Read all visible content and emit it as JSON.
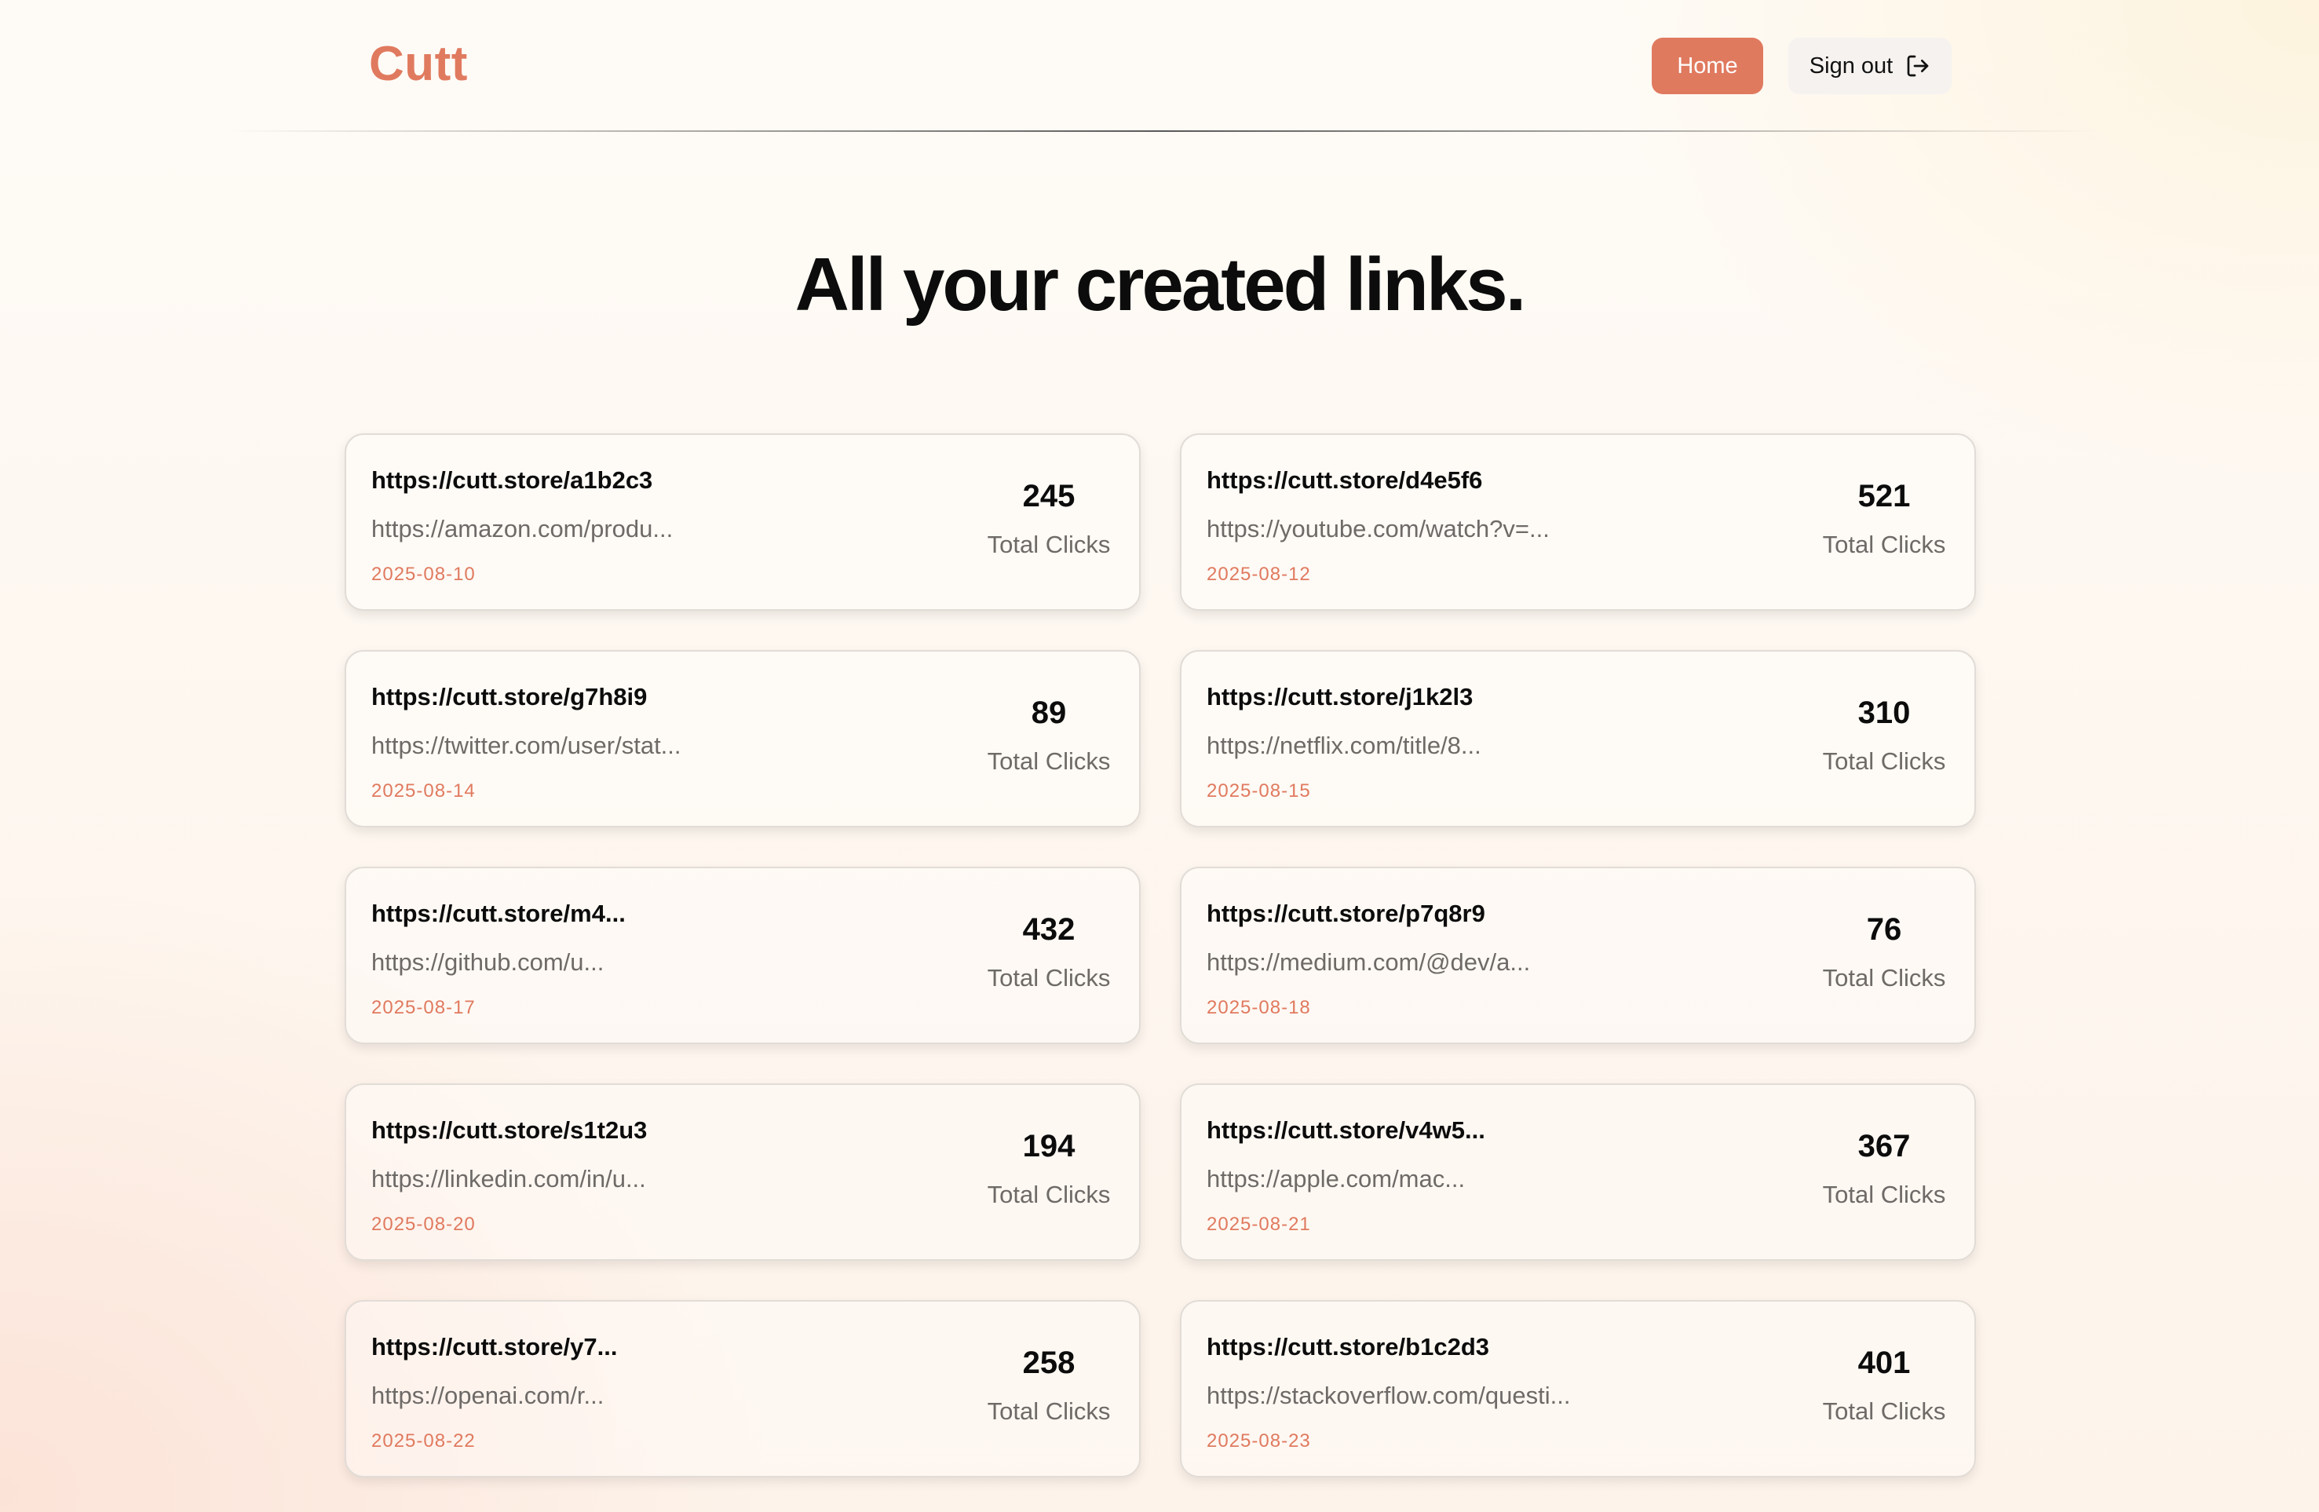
{
  "header": {
    "logo": "Cutt",
    "home_label": "Home",
    "signout_label": "Sign out"
  },
  "colors": {
    "accent": "#e07a5f",
    "text": "#0c0c0c",
    "muted": "#6e6a67"
  },
  "main": {
    "title": "All your created links.",
    "clicks_label": "Total Clicks",
    "links": [
      {
        "short": "https://cutt.store/a1b2c3",
        "original": "https://amazon.com/produ...",
        "date": "2025-08-10",
        "clicks": "245"
      },
      {
        "short": "https://cutt.store/d4e5f6",
        "original": "https://youtube.com/watch?v=...",
        "date": "2025-08-12",
        "clicks": "521"
      },
      {
        "short": "https://cutt.store/g7h8i9",
        "original": "https://twitter.com/user/stat...",
        "date": "2025-08-14",
        "clicks": "89"
      },
      {
        "short": "https://cutt.store/j1k2l3",
        "original": "https://netflix.com/title/8...",
        "date": "2025-08-15",
        "clicks": "310"
      },
      {
        "short": "https://cutt.store/m4...",
        "original": "https://github.com/u...",
        "date": "2025-08-17",
        "clicks": "432"
      },
      {
        "short": "https://cutt.store/p7q8r9",
        "original": "https://medium.com/@dev/a...",
        "date": "2025-08-18",
        "clicks": "76"
      },
      {
        "short": "https://cutt.store/s1t2u3",
        "original": "https://linkedin.com/in/u...",
        "date": "2025-08-20",
        "clicks": "194"
      },
      {
        "short": "https://cutt.store/v4w5...",
        "original": "https://apple.com/mac...",
        "date": "2025-08-21",
        "clicks": "367"
      },
      {
        "short": "https://cutt.store/y7...",
        "original": "https://openai.com/r...",
        "date": "2025-08-22",
        "clicks": "258"
      },
      {
        "short": "https://cutt.store/b1c2d3",
        "original": "https://stackoverflow.com/questi...",
        "date": "2025-08-23",
        "clicks": "401"
      }
    ]
  }
}
